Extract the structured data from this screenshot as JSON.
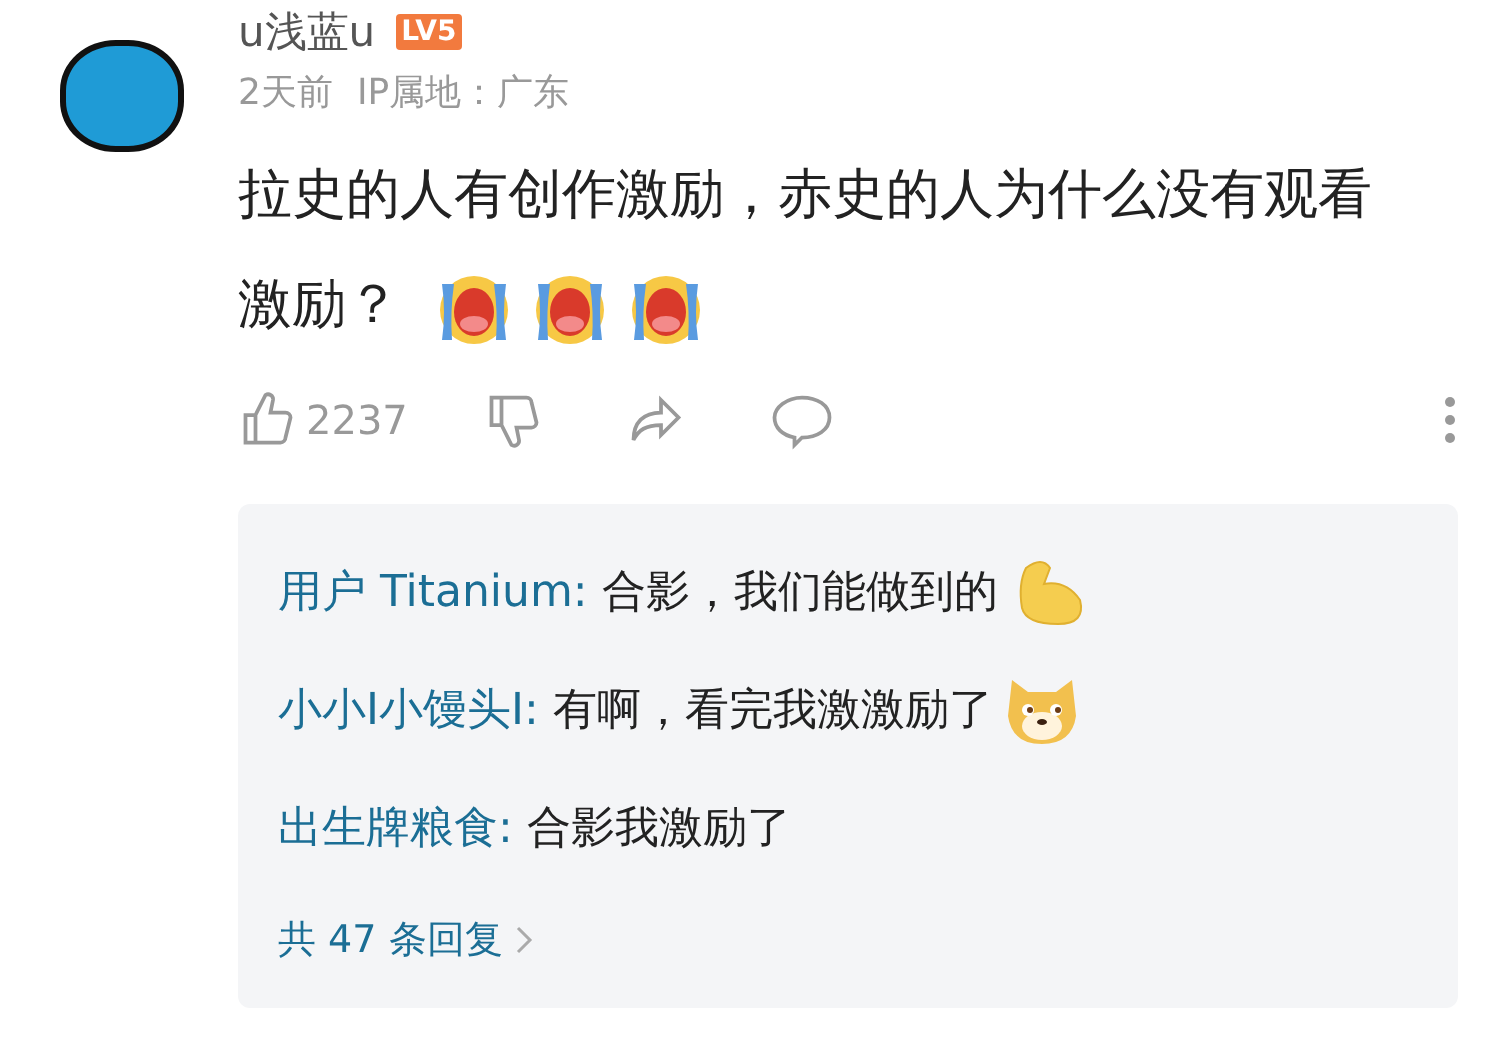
{
  "comment": {
    "username": "u浅蓝u",
    "level_badge": "LV5",
    "time": "2天前",
    "ip_location": "IP属地：广东",
    "text": "拉史的人有创作激励，赤史的人为什么没有观看激励？",
    "emojis": [
      {
        "kind": "cry"
      },
      {
        "kind": "cry"
      },
      {
        "kind": "cry"
      }
    ],
    "likes": "2237"
  },
  "replies": [
    {
      "user": "用户 Titanium:",
      "text": "合影，我们能做到的",
      "kind": "flex"
    },
    {
      "user": "小小I小馒头I:",
      "text": "有啊，看完我激激励了",
      "kind": "doge"
    },
    {
      "user": "出生牌粮食:",
      "text": "合影我激励了",
      "kind": "plain"
    }
  ],
  "more_replies": "共 47 条回复"
}
